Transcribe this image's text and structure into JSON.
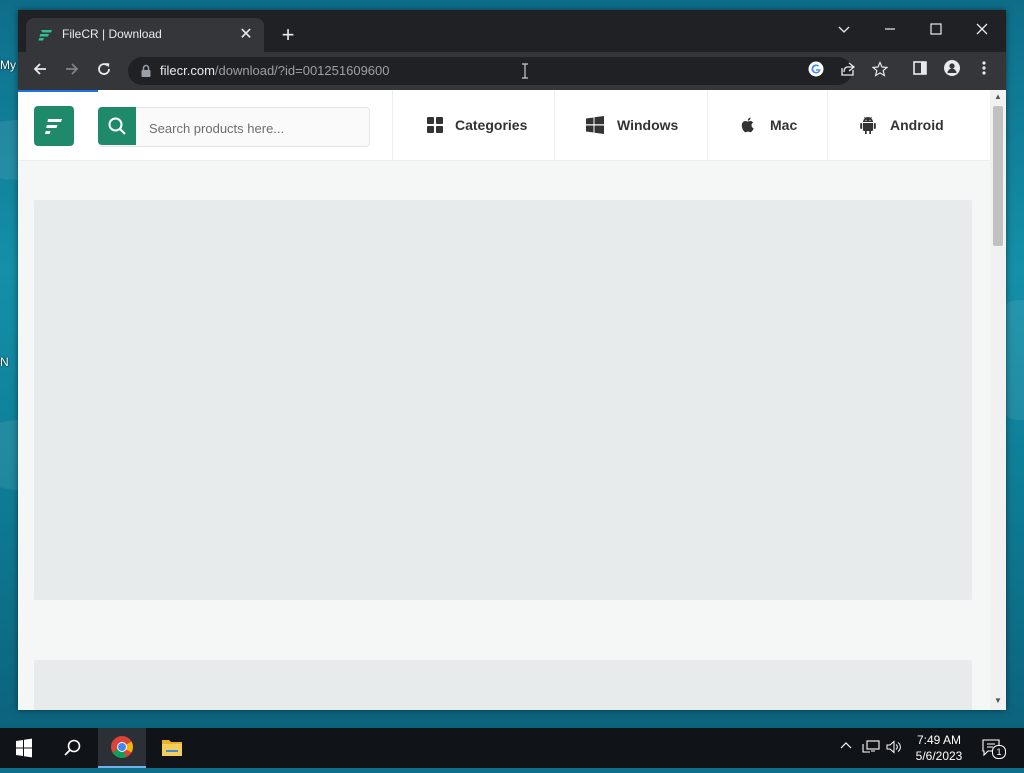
{
  "desktop": {
    "labels": [
      "My",
      "N"
    ]
  },
  "browser": {
    "tab": {
      "title": "FileCR | Download",
      "favicon": "filecr-logo-icon"
    },
    "new_tab_icon": "plus-icon",
    "window_controls": {
      "chevron": "chevron-down-icon",
      "minimize": "minimize-icon",
      "maximize": "maximize-icon",
      "close": "close-icon"
    },
    "nav": {
      "back": "arrow-left-icon",
      "forward": "arrow-right-icon",
      "reload": "reload-icon"
    },
    "address": {
      "host": "filecr.com",
      "path": "/download/?id=001251609600"
    },
    "omnibox_icons": [
      "google-icon",
      "share-icon",
      "star-icon"
    ],
    "toolbar_icons": [
      "side-panel-icon",
      "profile-icon",
      "menu-dots-icon"
    ]
  },
  "site": {
    "brand_color": "#1e8a6a",
    "search": {
      "placeholder": "Search products here..."
    },
    "nav": [
      {
        "label": "Categories",
        "icon": "grid-icon"
      },
      {
        "label": "Windows",
        "icon": "windows-icon"
      },
      {
        "label": "Mac",
        "icon": "apple-icon"
      },
      {
        "label": "Android",
        "icon": "android-icon"
      }
    ]
  },
  "taskbar": {
    "apps": [
      "start-icon",
      "search-icon",
      "chrome-icon",
      "file-explorer-icon"
    ],
    "tray_icons": [
      "chevron-up-icon",
      "network-icon",
      "volume-icon"
    ],
    "time": "7:49 AM",
    "date": "5/6/2023",
    "notification_count": "1"
  }
}
